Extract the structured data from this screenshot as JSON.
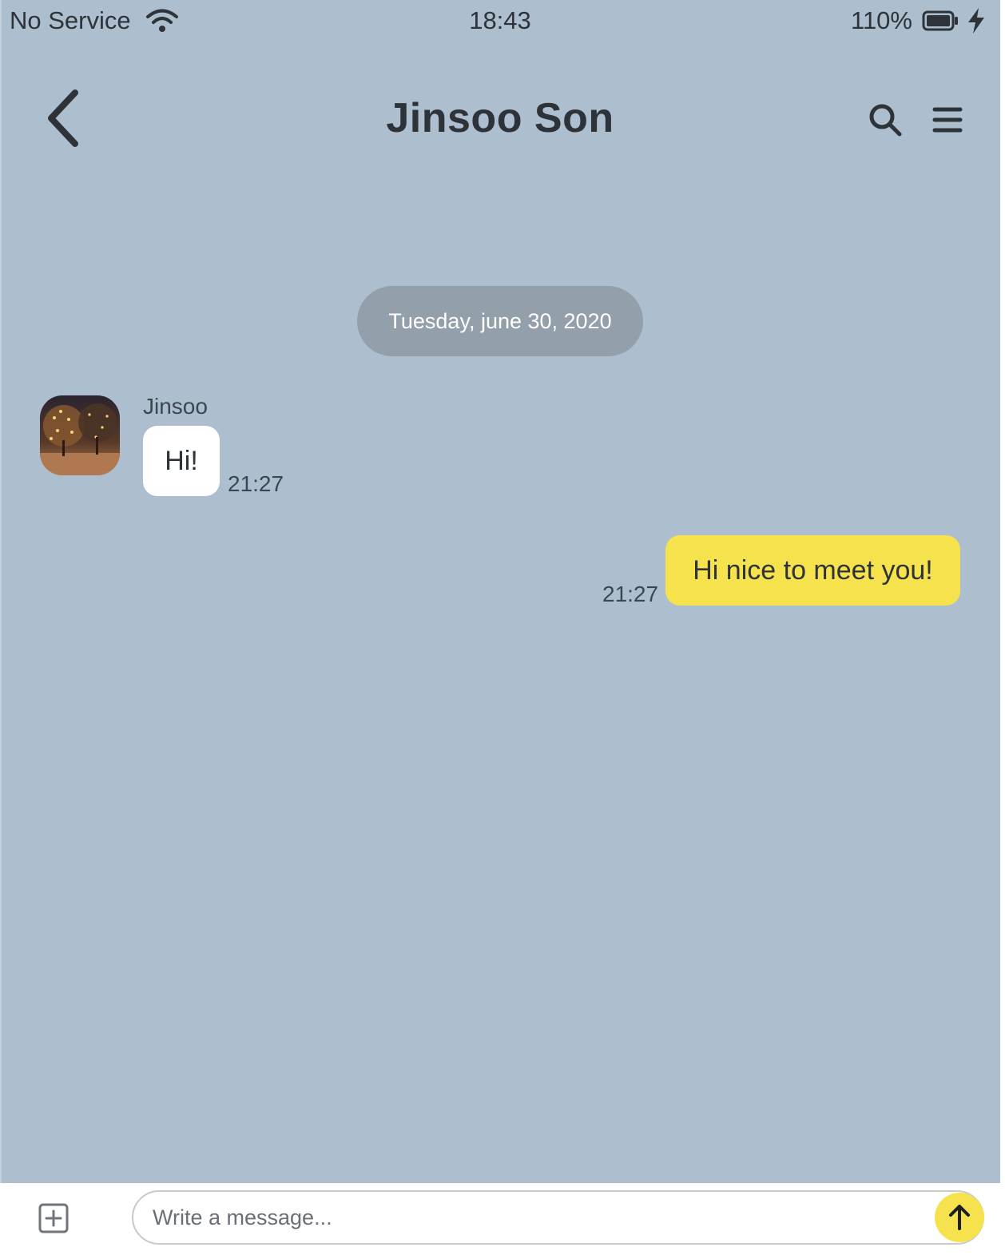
{
  "status_bar": {
    "carrier": "No Service",
    "time": "18:43",
    "battery": "110%"
  },
  "header": {
    "title": "Jinsoo Son",
    "icons": [
      "chevron-left-icon",
      "search-icon",
      "hamburger-menu-icon"
    ]
  },
  "chat": {
    "date_separator": "Tuesday, june 30, 2020",
    "messages": [
      {
        "direction": "incoming",
        "sender": "Jinsoo",
        "text": "Hi!",
        "time": "21:27"
      },
      {
        "direction": "outgoing",
        "text": "Hi nice to meet you!",
        "time": "21:27"
      }
    ]
  },
  "composer": {
    "placeholder": "Write a message...",
    "value": "",
    "icons": [
      "plus-square-icon",
      "arrow-up-icon"
    ]
  },
  "colors": {
    "background": "#adbfcf",
    "date_pill": "#939fab",
    "incoming_bubble": "#ffffff",
    "outgoing_bubble": "#f5e24c",
    "send_button": "#f5e24c",
    "text": "#2d3339"
  }
}
